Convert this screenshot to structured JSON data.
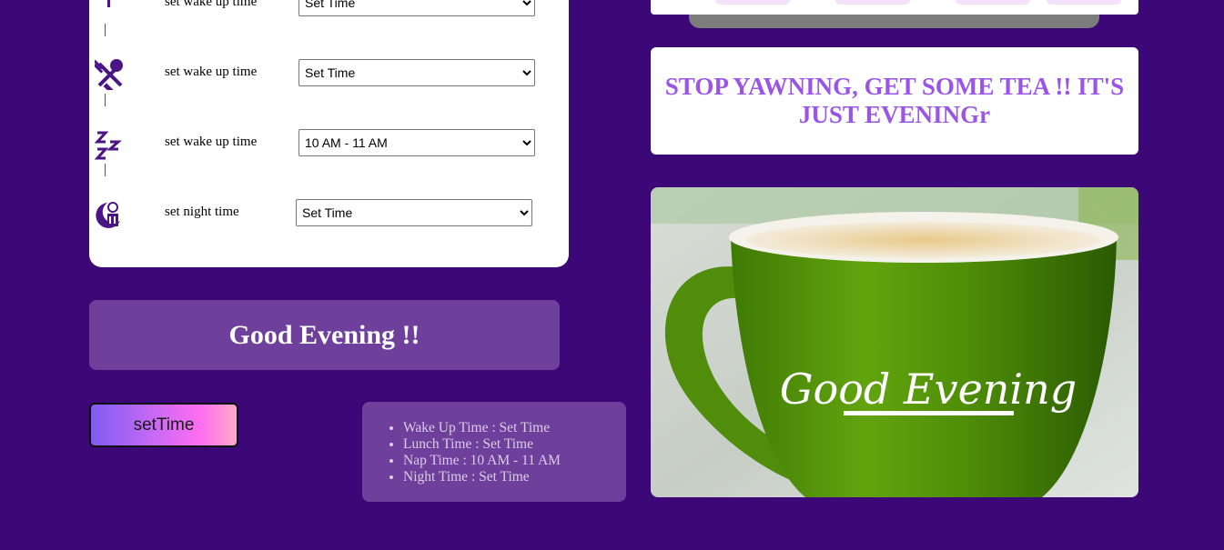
{
  "schedule": {
    "rows": [
      {
        "label": "set wake up time",
        "selected": "Set Time",
        "icon": "sun-icon"
      },
      {
        "label": "set wake up time",
        "selected": "Set Time",
        "icon": "fork-spoon-icon"
      },
      {
        "label": "set wake up time",
        "selected": "10 AM - 11 AM",
        "icon": "sleep-zzz-icon"
      },
      {
        "label": "set night time",
        "selected": "Set Time",
        "icon": "moon-night-icon"
      }
    ]
  },
  "greeting": {
    "text": "Good Evening !!"
  },
  "button": {
    "label": "setTime"
  },
  "summary": {
    "items": [
      "Wake Up Time : Set Time",
      "Lunch Time : Set Time",
      "Nap Time : 10 AM - 11 AM",
      "Night Time : Set Time"
    ]
  },
  "message": {
    "text": "STOP YAWNING, GET SOME TEA !! IT'S JUST EVENINGr"
  },
  "image": {
    "caption": "Good Evening"
  },
  "colors": {
    "background": "#3c0878",
    "panel": "#6e409c",
    "accent_text": "#9a55e8",
    "icon": "#4a1585"
  }
}
